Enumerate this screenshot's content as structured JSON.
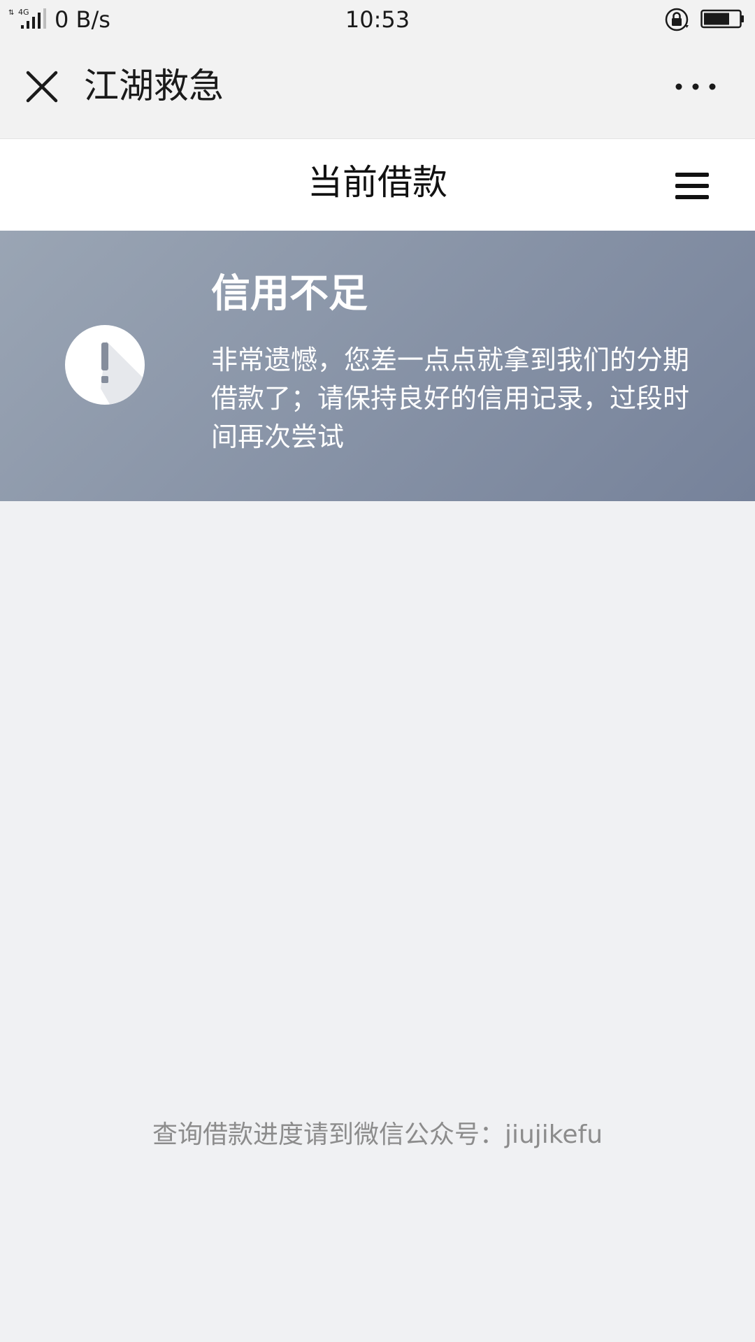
{
  "status_bar": {
    "network_type": "4G",
    "net_speed": "0 B/s",
    "time": "10:53"
  },
  "title_bar": {
    "app_title": "江湖救急"
  },
  "page_header": {
    "title": "当前借款"
  },
  "notice": {
    "heading": "信用不足",
    "message": "非常遗憾，您差一点点就拿到我们的分期借款了；请保持良好的信用记录，过段时间再次尝试"
  },
  "footer": {
    "note": "查询借款进度请到微信公众号：jiujikefu"
  },
  "colors": {
    "banner_start": "#9aa5b4",
    "banner_end": "#76829a",
    "page_background": "#f0f1f3"
  }
}
